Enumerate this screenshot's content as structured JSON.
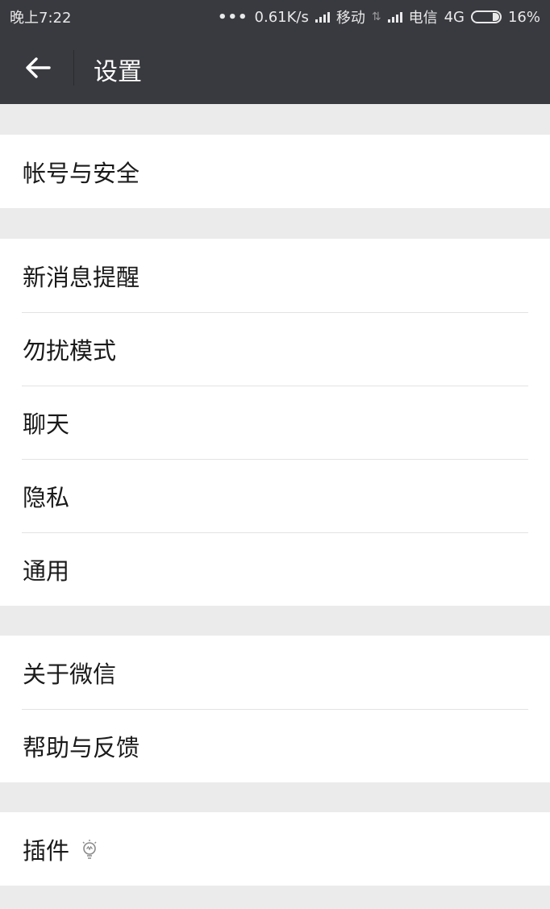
{
  "status_bar": {
    "time": "晚上7:22",
    "dots": "•••",
    "network_speed": "0.61K/s",
    "carrier1": "移动",
    "carrier2": "电信",
    "network_type": "4G",
    "battery_percent": "16%",
    "battery_level": 0.16
  },
  "nav": {
    "back_icon": "arrow-left-icon",
    "title": "设置"
  },
  "groups": [
    {
      "items": [
        {
          "label": "帐号与安全"
        }
      ]
    },
    {
      "items": [
        {
          "label": "新消息提醒"
        },
        {
          "label": "勿扰模式"
        },
        {
          "label": "聊天"
        },
        {
          "label": "隐私"
        },
        {
          "label": "通用"
        }
      ]
    },
    {
      "items": [
        {
          "label": "关于微信"
        },
        {
          "label": "帮助与反馈"
        }
      ]
    },
    {
      "items": [
        {
          "label": "插件",
          "icon": "lightbulb-icon"
        }
      ]
    }
  ]
}
